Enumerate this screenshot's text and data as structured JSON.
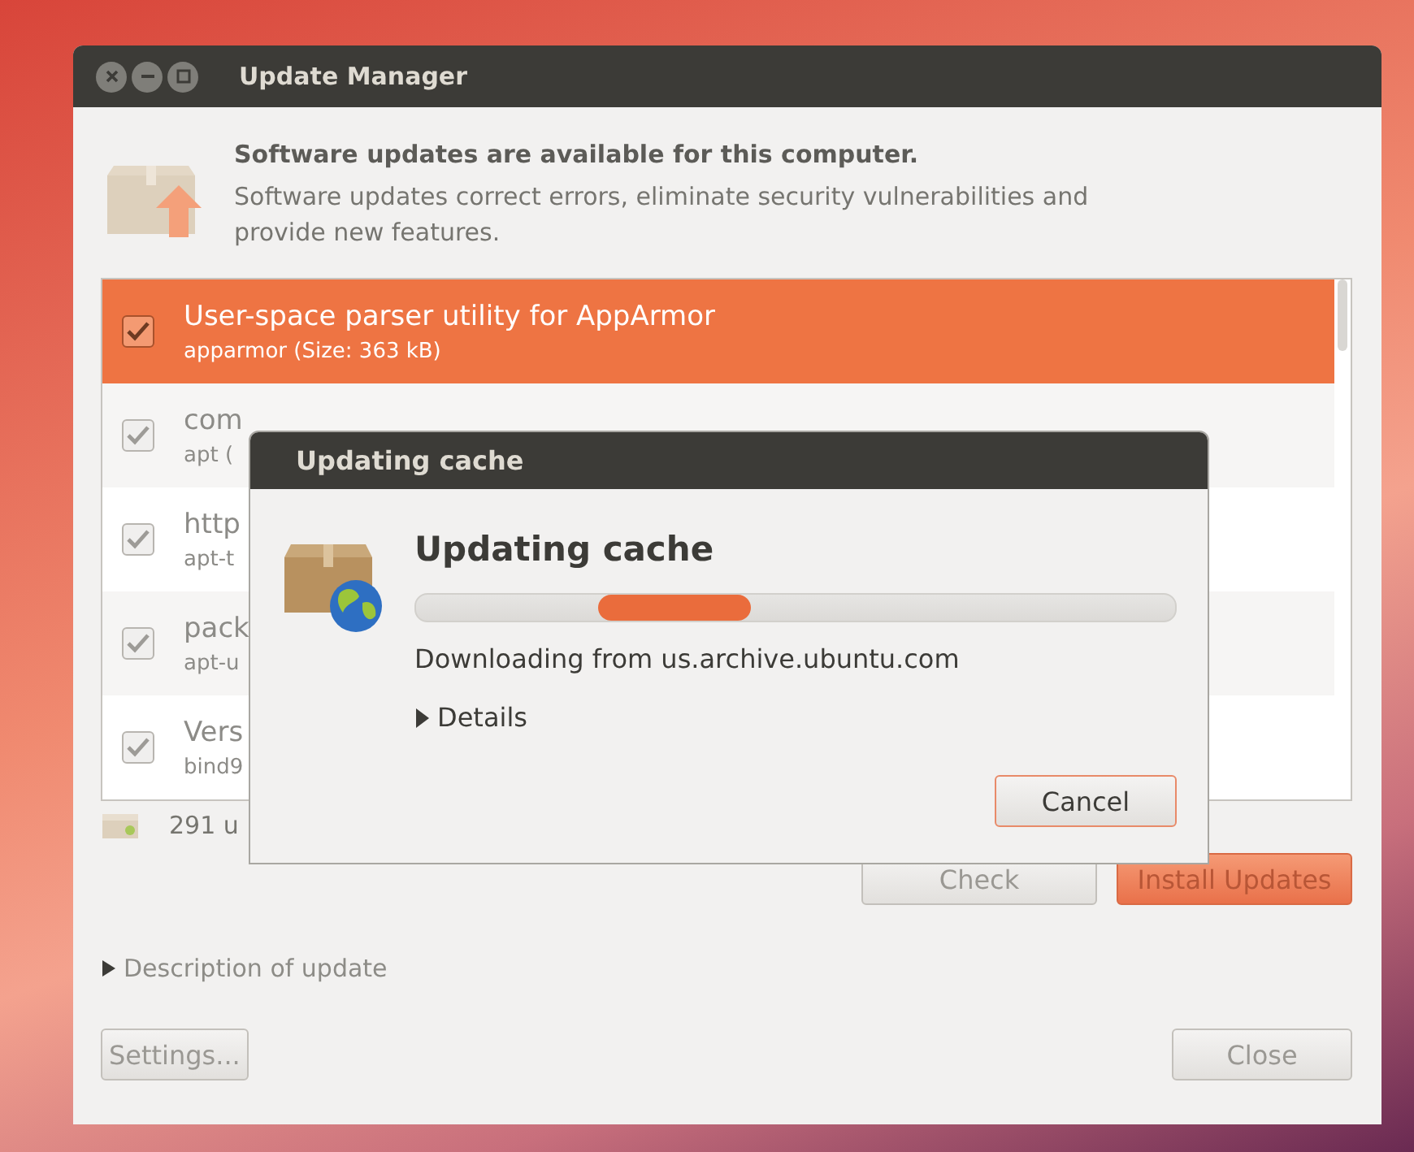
{
  "window": {
    "title": "Update Manager"
  },
  "header": {
    "title": "Software updates are available for this computer.",
    "description": "Software updates correct errors, eliminate security vulnerabilities and provide new features."
  },
  "updates": [
    {
      "name": "User-space parser utility for AppArmor",
      "detail": "apparmor (Size: 363 kB)",
      "checked": true,
      "selected": true
    },
    {
      "name": "com",
      "detail": "apt (",
      "checked": true,
      "selected": false
    },
    {
      "name": "http",
      "detail": "apt-t",
      "checked": true,
      "selected": false
    },
    {
      "name": "pack",
      "detail": "apt-u",
      "checked": true,
      "selected": false
    },
    {
      "name": "Vers",
      "detail": "bind9",
      "checked": true,
      "selected": false
    }
  ],
  "status": "291 u",
  "actions": [
    {
      "label": "Check",
      "kind": "normal"
    },
    {
      "label": "Install Updates",
      "kind": "default"
    }
  ],
  "description": {
    "label": "Description of update",
    "expanded": false
  },
  "footer": {
    "left": "Settings...",
    "right": "Close"
  },
  "dialog": {
    "title": "Updating cache",
    "heading": "Updating cache",
    "progress": {
      "level": 0.34
    },
    "status": "Downloading from us.archive.ubuntu.com",
    "details": {
      "label": "Details",
      "expanded": false
    },
    "cancel": "Cancel"
  }
}
